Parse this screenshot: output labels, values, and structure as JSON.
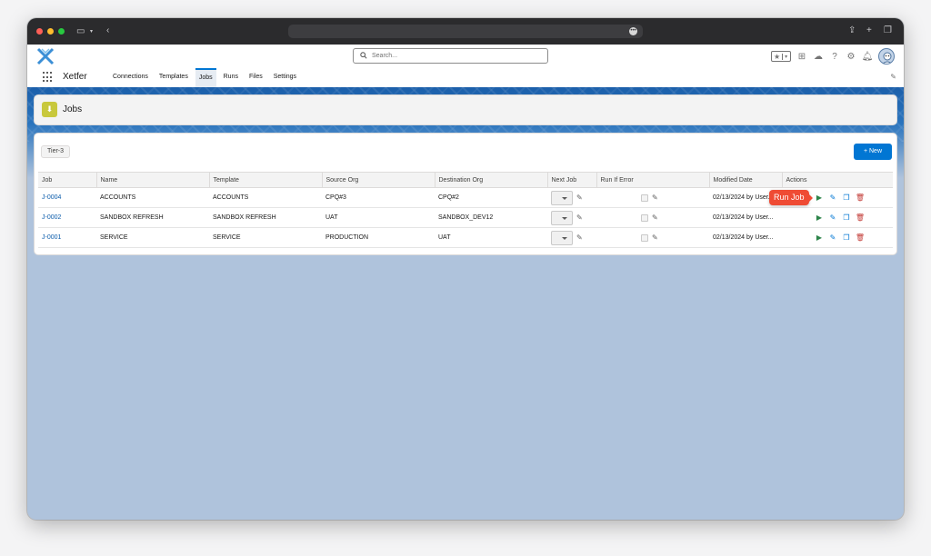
{
  "app": {
    "name": "Xetfer"
  },
  "search": {
    "placeholder": "Search..."
  },
  "nav": {
    "tabs": [
      "Connections",
      "Templates",
      "Jobs",
      "Runs",
      "Files",
      "Settings"
    ],
    "active": "Jobs"
  },
  "page": {
    "title": "Jobs",
    "tier": "Tier-3",
    "new_button": "+ New"
  },
  "table": {
    "columns": [
      "Job",
      "Name",
      "Template",
      "Source Org",
      "Destination Org",
      "Next Job",
      "Run If Error",
      "Modified Date",
      "Actions"
    ],
    "rows": [
      {
        "job": "J-0004",
        "name": "ACCOUNTS",
        "template": "ACCOUNTS",
        "source": "CPQ#3",
        "destination": "CPQ#2",
        "modified": "02/13/2024 by User..."
      },
      {
        "job": "J-0002",
        "name": "SANDBOX REFRESH",
        "template": "SANDBOX REFRESH",
        "source": "UAT",
        "destination": "SANDBOX_DEV12",
        "modified": "02/13/2024 by User..."
      },
      {
        "job": "J-0001",
        "name": "SERVICE",
        "template": "SERVICE",
        "source": "PRODUCTION",
        "destination": "UAT",
        "modified": "02/13/2024 by User..."
      }
    ]
  },
  "tooltip": {
    "text": "Run Job"
  },
  "colors": {
    "brand": "#0176d3",
    "banner": "#1b5faa",
    "background": "#afc3dc",
    "run": "#2e844a",
    "delete": "#c23934",
    "tooltip": "#ef4b34"
  },
  "icons": [
    "sidebar-icon",
    "back-icon",
    "share-icon",
    "plus-icon",
    "tabs-icon",
    "search-icon",
    "favorites-icon",
    "add-icon",
    "cloud-icon",
    "help-icon",
    "gear-icon",
    "bell-icon",
    "avatar",
    "waffle-icon",
    "pencil-icon",
    "play-icon",
    "clone-icon",
    "trash-icon"
  ]
}
